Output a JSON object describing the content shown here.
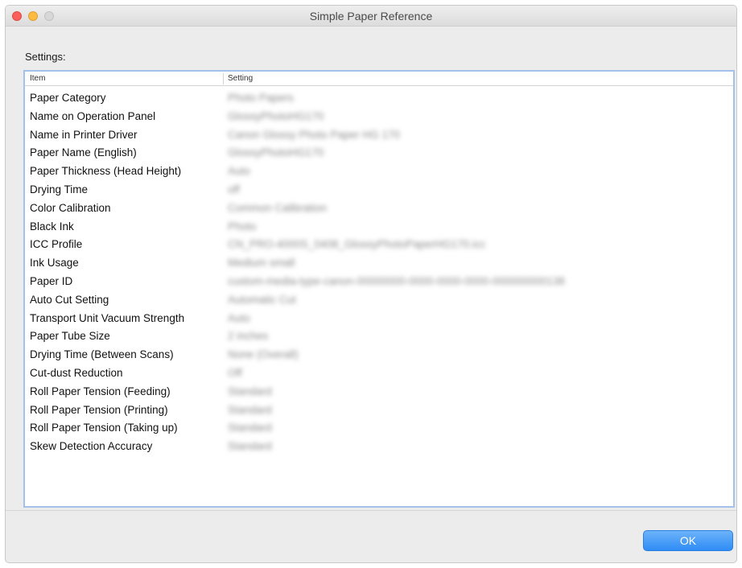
{
  "window": {
    "title": "Simple Paper Reference"
  },
  "settings_label": "Settings:",
  "table": {
    "columns": [
      "Item",
      "Setting"
    ],
    "rows": [
      {
        "item": "Paper Category",
        "setting": "Photo Papers"
      },
      {
        "item": "Name on Operation Panel",
        "setting": "GlossyPhotoHG170"
      },
      {
        "item": "Name in Printer Driver",
        "setting": "Canon Glossy Photo Paper HG 170"
      },
      {
        "item": "Paper Name (English)",
        "setting": "GlossyPhotoHG170"
      },
      {
        "item": "Paper Thickness (Head Height)",
        "setting": "Auto"
      },
      {
        "item": "Drying Time",
        "setting": "off"
      },
      {
        "item": "Color Calibration",
        "setting": "Common Calibration"
      },
      {
        "item": "Black Ink",
        "setting": "Photo"
      },
      {
        "item": "ICC Profile",
        "setting": "CN_PRO-4000S_0408_GlossyPhotoPaperHG170.icc"
      },
      {
        "item": "Ink Usage",
        "setting": "Medium small"
      },
      {
        "item": "Paper ID",
        "setting": "custom-media-type-canon-00000000-0000-0000-0000-000000000138"
      },
      {
        "item": "Auto Cut Setting",
        "setting": "Automatic Cut"
      },
      {
        "item": "Transport Unit Vacuum Strength",
        "setting": "Auto"
      },
      {
        "item": "Paper Tube Size",
        "setting": "2 inches"
      },
      {
        "item": "Drying Time (Between Scans)",
        "setting": "None (Overall)"
      },
      {
        "item": "Cut-dust Reduction",
        "setting": "Off"
      },
      {
        "item": "Roll Paper Tension (Feeding)",
        "setting": "Standard"
      },
      {
        "item": "Roll Paper Tension (Printing)",
        "setting": "Standard"
      },
      {
        "item": "Roll Paper Tension (Taking up)",
        "setting": "Standard"
      },
      {
        "item": "Skew Detection Accuracy",
        "setting": "Standard"
      }
    ]
  },
  "ok_label": "OK",
  "colors": {
    "close_light": "#fc605b",
    "minimize_light": "#fdbc40",
    "zoom_light_disabled": "#d7d7d7",
    "selection_border": "#a3c1ea",
    "ok_button": "#2f8cf5"
  }
}
